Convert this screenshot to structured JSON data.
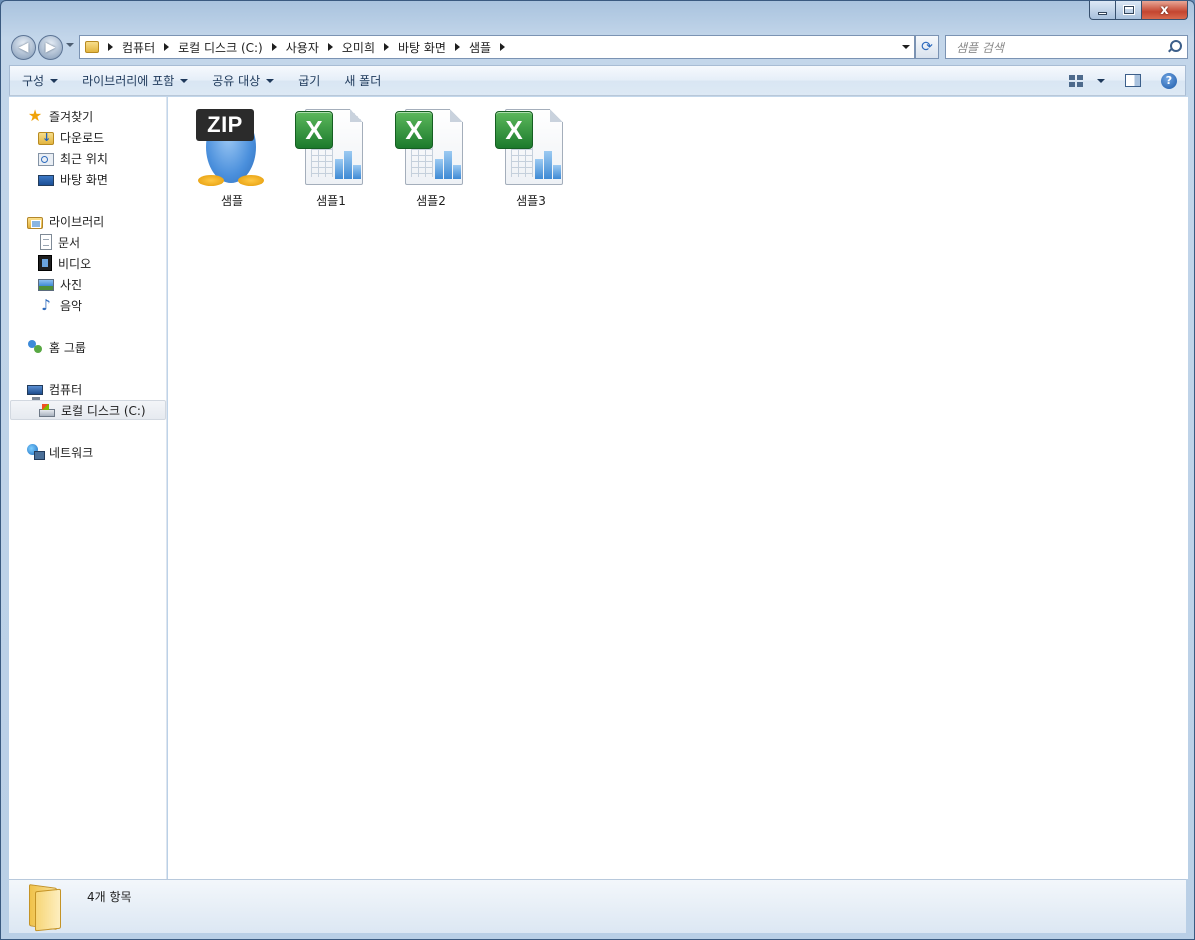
{
  "window": {
    "caption": {
      "minimize": "−",
      "maximize": "□",
      "close": "x"
    }
  },
  "nav": {
    "back_glyph": "◀",
    "forward_glyph": "▶",
    "breadcrumbs": [
      "컴퓨터",
      "로컬 디스크 (C:)",
      "사용자",
      "오미희",
      "바탕 화면",
      "샘플"
    ],
    "refresh_glyph": "⟳",
    "search_placeholder": "샘플 검색"
  },
  "toolbar": {
    "organize": "구성",
    "include_in_library": "라이브러리에 포함",
    "share_with": "공유 대상",
    "burn": "굽기",
    "new_folder": "새 폴더",
    "help": "?"
  },
  "sidebar": {
    "favorites": {
      "header": "즐겨찾기",
      "items": [
        "다운로드",
        "최근 위치",
        "바탕 화면"
      ]
    },
    "libraries": {
      "header": "라이브러리",
      "items": [
        "문서",
        "비디오",
        "사진",
        "음악"
      ]
    },
    "homegroup": {
      "header": "홈 그룹"
    },
    "computer": {
      "header": "컴퓨터",
      "items": [
        "로컬 디스크 (C:)"
      ],
      "selected": "로컬 디스크 (C:)"
    },
    "network": {
      "header": "네트워크"
    }
  },
  "files": [
    {
      "name": "샘플",
      "type": "zip",
      "badge": "ZIP"
    },
    {
      "name": "샘플1",
      "type": "xlsx",
      "badge": "X"
    },
    {
      "name": "샘플2",
      "type": "xlsx",
      "badge": "X"
    },
    {
      "name": "샘플3",
      "type": "xlsx",
      "badge": "X"
    }
  ],
  "status": {
    "item_count": "4개 항목"
  },
  "colors": {
    "frame": "#b9cfe6",
    "close_button": "#c44530",
    "selection": "#e6eaf0"
  }
}
